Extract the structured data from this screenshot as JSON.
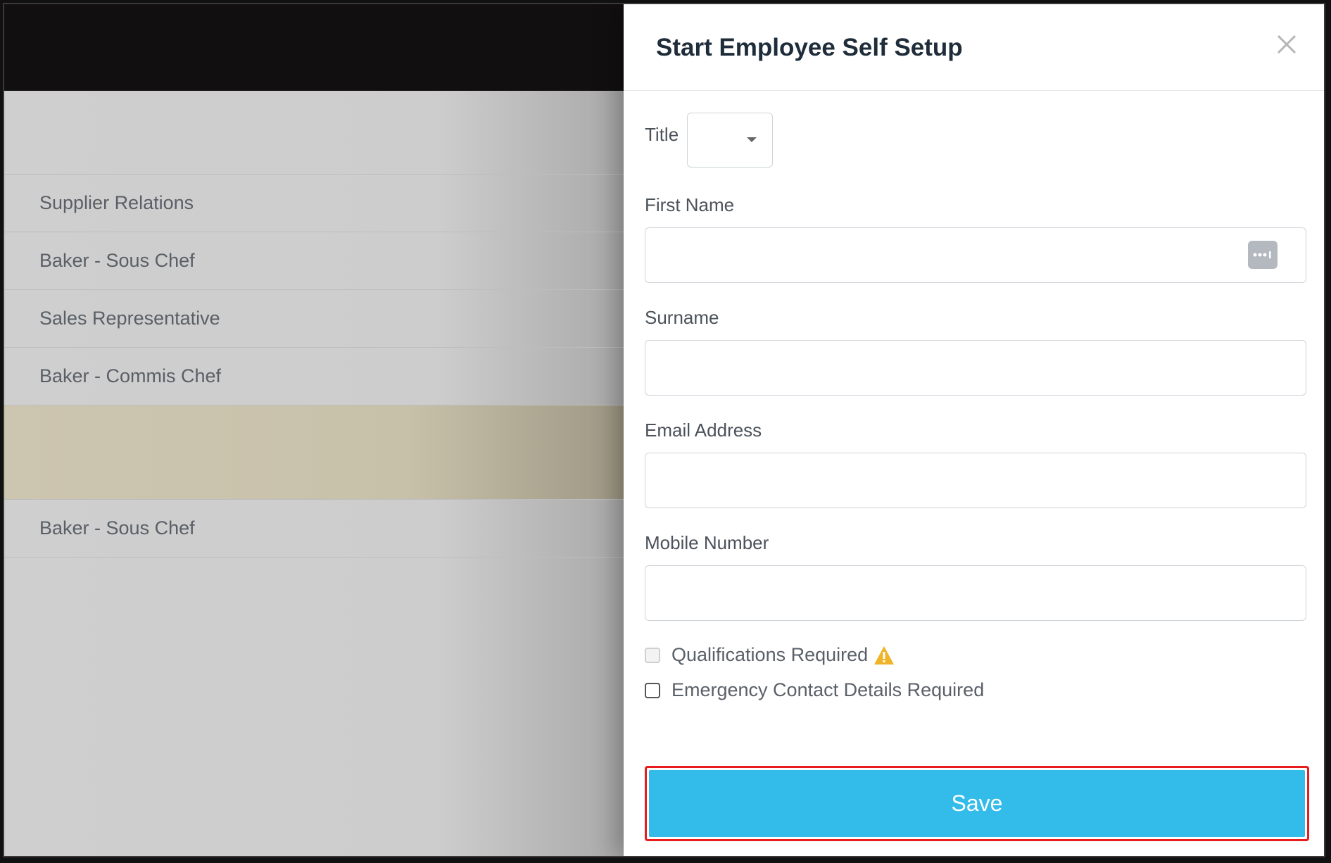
{
  "background_list": {
    "rows": [
      "Supplier Relations",
      "Baker - Sous Chef",
      "Sales Representative",
      "Baker - Commis Chef",
      "",
      "Baker - Sous Chef"
    ]
  },
  "panel": {
    "title": "Start Employee Self Setup",
    "close_icon": "close-icon"
  },
  "form": {
    "title_label": "Title",
    "title_value": "",
    "first_name_label": "First Name",
    "first_name_value": "",
    "surname_label": "Surname",
    "surname_value": "",
    "email_label": "Email Address",
    "email_value": "",
    "mobile_label": "Mobile Number",
    "mobile_value": "",
    "qualifications_label": "Qualifications Required",
    "emergency_label": "Emergency Contact Details Required",
    "save_label": "Save"
  },
  "colors": {
    "save_button": "#33bbea",
    "highlight_border": "#e81c1c",
    "warning": "#f0b429"
  }
}
